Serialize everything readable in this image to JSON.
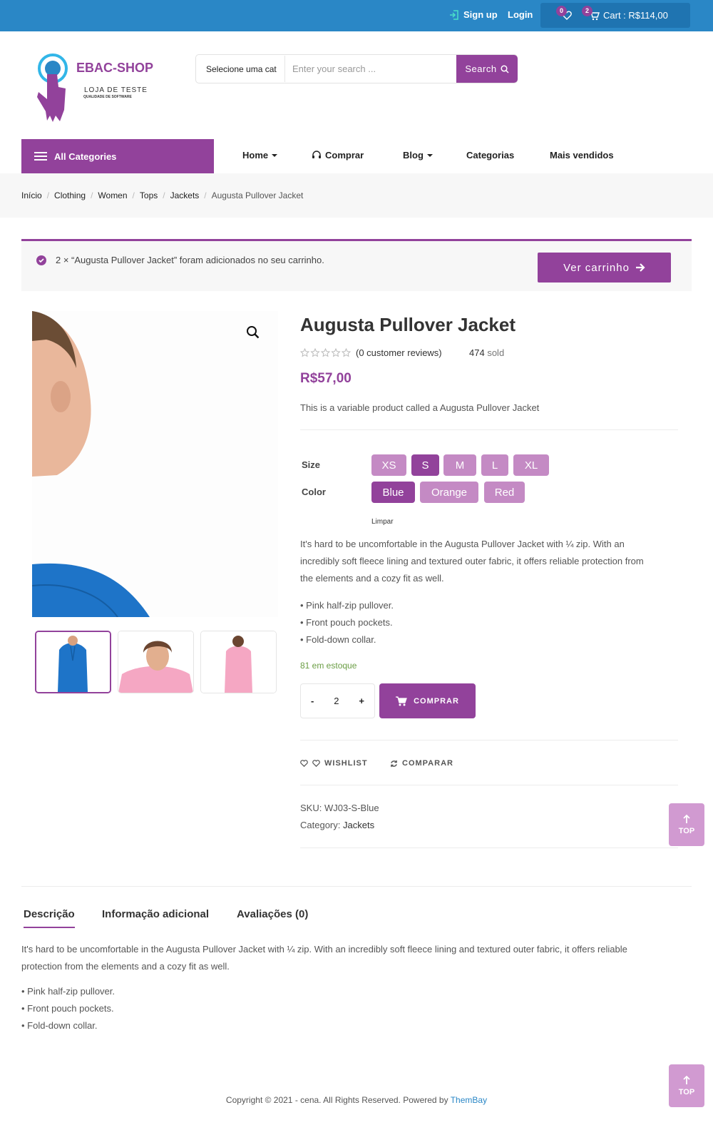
{
  "topbar": {
    "signup": "Sign up",
    "login": "Login",
    "wishlist_count": "0",
    "cart_count": "2",
    "cart_label": "Cart : R$114,00"
  },
  "logo": {
    "title": "EBAC-SHOP",
    "subtitle": "LOJA DE TESTE",
    "tagline": "QUALIDADE DE SOFTWARE"
  },
  "search": {
    "category": "Selecione uma cat",
    "placeholder": "Enter your search ...",
    "button": "Search"
  },
  "nav": {
    "all_categories": "All Categories",
    "items": [
      "Home",
      "Comprar",
      "Blog",
      "Categorias",
      "Mais vendidos"
    ]
  },
  "breadcrumb": [
    "Início",
    "Clothing",
    "Women",
    "Tops",
    "Jackets",
    "Augusta Pullover Jacket"
  ],
  "notice": {
    "text": "2 × “Augusta Pullover Jacket” foram adicionados no seu carrinho.",
    "button": "Ver carrinho"
  },
  "product": {
    "title": "Augusta Pullover Jacket",
    "reviews": "(0 customer reviews)",
    "sold_count": "474",
    "sold_label": "sold",
    "price": "R$57,00",
    "short_description": "This is a variable product called a Augusta Pullover Jacket",
    "size_label": "Size",
    "sizes": [
      "XS",
      "S",
      "M",
      "L",
      "XL"
    ],
    "selected_size": "S",
    "color_label": "Color",
    "colors": [
      "Blue",
      "Orange",
      "Red"
    ],
    "selected_color": "Blue",
    "clear": "Limpar",
    "description_lines": [
      "It's hard to be uncomfortable in the Augusta Pullover Jacket with ¼ zip. With an",
      "incredibly soft fleece lining and textured outer fabric, it offers reliable protection from",
      "the elements and a cozy fit as well."
    ],
    "features": [
      "• Pink half-zip pullover.",
      "• Front pouch pockets.",
      "• Fold-down collar."
    ],
    "stock": "81 em estoque",
    "qty_minus": "-",
    "qty": "2",
    "qty_plus": "+",
    "buy": "COMPRAR",
    "wishlist": "WISHLIST",
    "compare": "COMPARAR",
    "sku_label": "SKU:",
    "sku": "WJ03-S-Blue",
    "category_label": "Category:",
    "category": "Jackets"
  },
  "top_button": "TOP",
  "tabs": [
    "Descrição",
    "Informação adicional",
    "Avaliações (0)"
  ],
  "tab_description": {
    "lines": [
      "It's hard to be uncomfortable in the Augusta Pullover Jacket with ¼ zip. With an incredibly soft fleece lining and textured outer fabric, it offers reliable",
      "protection from the elements and a cozy fit as well."
    ],
    "features": [
      "• Pink half-zip pullover.",
      "• Front pouch pockets.",
      "• Fold-down collar."
    ]
  },
  "footer": {
    "text": "Copyright © 2021 - cena. All Rights Reserved. Powered by",
    "link": "ThemBay"
  },
  "colors": {
    "brand": "#92429b",
    "topbar": "#2a87c6",
    "swatch": "#c48ac4",
    "stock": "#6b9e45"
  }
}
